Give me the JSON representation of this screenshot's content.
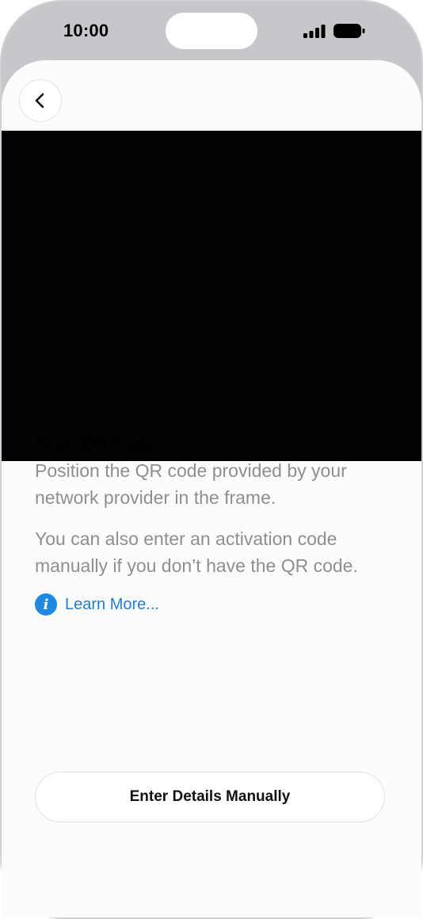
{
  "status_bar": {
    "time": "10:00",
    "signal_icon": "cellular-signal-icon",
    "battery_icon": "battery-icon"
  },
  "nav": {
    "back_icon": "chevron-left-icon"
  },
  "camera": {
    "background": "#020304"
  },
  "content": {
    "title": "Scan QR Code",
    "description_1": "Position the QR code provided by your network provider in the frame.",
    "description_2": "You can also enter an activation code manually if you don’t have the QR code.",
    "learn_more_label": "Learn More...",
    "info_icon": "info-icon"
  },
  "footer": {
    "manual_button_label": "Enter Details Manually"
  },
  "colors": {
    "link": "#1a7fd9",
    "info_icon": "#1e88e5",
    "secondary_text": "#8e8e93",
    "bezel": "#c6c6cb"
  }
}
